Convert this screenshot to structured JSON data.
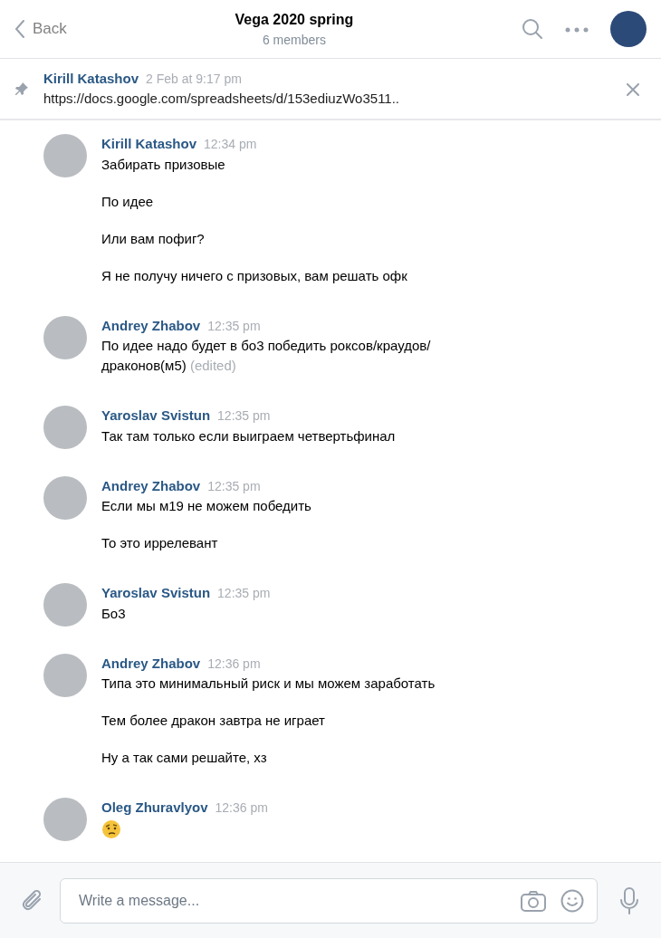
{
  "header": {
    "back_label": "Back",
    "title": "Vega 2020 spring",
    "subtitle": "6 members"
  },
  "pinned": {
    "author": "Kirill Katashov",
    "time": "2 Feb at 9:17 pm",
    "text": "https://docs.google.com/spreadsheets/d/153ediuzWo3511.."
  },
  "messages": [
    {
      "author": "Kirill Katashov",
      "time": "12:34 pm",
      "lines": [
        {
          "kind": "text",
          "text": "Забирать призовые"
        },
        {
          "kind": "text",
          "text": "По идее"
        },
        {
          "kind": "text",
          "text": "Или вам пофиг?"
        },
        {
          "kind": "text",
          "text": "Я не получу ничего с призовых, вам решать офк"
        }
      ]
    },
    {
      "author": "Andrey Zhabov",
      "time": "12:35 pm",
      "lines": [
        {
          "kind": "text",
          "text": "По идее надо будет в бо3 победить роксов/краудов/ драконов(м5)",
          "edited_label": "(edited)"
        }
      ]
    },
    {
      "author": "Yaroslav Svistun",
      "time": "12:35 pm",
      "lines": [
        {
          "kind": "text",
          "text": "Так там только если выиграем четвертьфинал"
        }
      ]
    },
    {
      "author": "Andrey Zhabov",
      "time": "12:35 pm",
      "lines": [
        {
          "kind": "text",
          "text": "Если мы м19 не можем победить"
        },
        {
          "kind": "text",
          "text": "То это иррелевант"
        }
      ]
    },
    {
      "author": "Yaroslav Svistun",
      "time": "12:35 pm",
      "lines": [
        {
          "kind": "text",
          "text": "Бо3"
        }
      ]
    },
    {
      "author": "Andrey Zhabov",
      "time": "12:36 pm",
      "lines": [
        {
          "kind": "text",
          "text": "Типа это минимальный риск и мы можем заработать"
        },
        {
          "kind": "text",
          "text": "Тем более дракон завтра не играет"
        },
        {
          "kind": "text",
          "text": "Ну а так сами решайте, хз"
        }
      ]
    },
    {
      "author": "Oleg Zhuravlyov",
      "time": "12:36 pm",
      "lines": [
        {
          "kind": "emoji"
        }
      ]
    }
  ],
  "composer": {
    "placeholder": "Write a message..."
  }
}
